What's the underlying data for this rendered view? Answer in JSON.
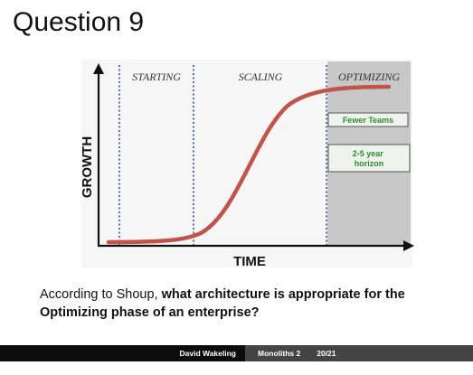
{
  "slide": {
    "title": "Question 9"
  },
  "diagram": {
    "phases": [
      "STARTING",
      "SCALING",
      "OPTIMIZING"
    ],
    "x_axis_label": "TIME",
    "y_axis_label": "GROWTH",
    "boxes": [
      "Fewer Teams",
      "2-5 year horizon"
    ],
    "colors": {
      "curve": "#c0534a",
      "shade": "#c8c8c8",
      "divider": "#2f4fa0",
      "box_text": "#2e8b2e"
    }
  },
  "question": {
    "prefix": "According to Shoup,",
    "bold": "what architecture is appropriate for the Optimizing phase of an enterprise?"
  },
  "footer": {
    "author": "David Wakeling",
    "deck": "Monoliths 2",
    "page": "20/21"
  }
}
